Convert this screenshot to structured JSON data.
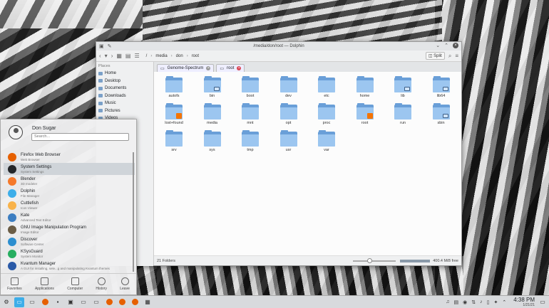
{
  "window": {
    "title": "/media/don/root — Dolphin",
    "breadcrumb": [
      "/",
      "media",
      "don",
      "root"
    ],
    "split_label": "Split",
    "tabs": [
      {
        "label": "Genome-Spectrum"
      },
      {
        "label": "root"
      }
    ],
    "places_header": "Places",
    "places": [
      "Home",
      "Desktop",
      "Documents",
      "Downloads",
      "Music",
      "Pictures",
      "Videos"
    ],
    "folders": [
      "autofs",
      "bin",
      "boot",
      "dev",
      "etc",
      "home",
      "lib",
      "lib64",
      "lost+found",
      "media",
      "mnt",
      "opt",
      "proc",
      "root",
      "run",
      "sbin",
      "srv",
      "sys",
      "tmp",
      "usr",
      "var"
    ],
    "status_left": "21 Folders",
    "status_right": "400.4 MiB free"
  },
  "launcher": {
    "user": "Don Sugar",
    "search_placeholder": "Search...",
    "apps": [
      {
        "name": "Firefox Web Browser",
        "desc": "Web Browser",
        "color": "#e66000"
      },
      {
        "name": "System Settings",
        "desc": "System Settings",
        "color": "#232629"
      },
      {
        "name": "Blender",
        "desc": "3D modeler",
        "color": "#f5792a"
      },
      {
        "name": "Dolphin",
        "desc": "File Manager",
        "color": "#3daee9"
      },
      {
        "name": "Cuttlefish",
        "desc": "Icon Viewer",
        "color": "#f8b24a"
      },
      {
        "name": "Kate",
        "desc": "Advanced Text Editor",
        "color": "#3b7dc1"
      },
      {
        "name": "GNU Image Manipulation Program",
        "desc": "Image Editor",
        "color": "#6b5d46"
      },
      {
        "name": "Discover",
        "desc": "Software Center",
        "color": "#2c8ecf"
      },
      {
        "name": "KSysGuard",
        "desc": "System Monitor",
        "color": "#27ae60"
      },
      {
        "name": "Kvantum Manager",
        "desc": "A GUI for installing, sele...g and manipulating Kvantum themes",
        "color": "#2a5aa8"
      }
    ],
    "footer": [
      "Favorites",
      "Applications",
      "Computer",
      "History",
      "Leave"
    ]
  },
  "taskbar": {
    "time": "4:38 PM",
    "date": "1/21/21"
  }
}
